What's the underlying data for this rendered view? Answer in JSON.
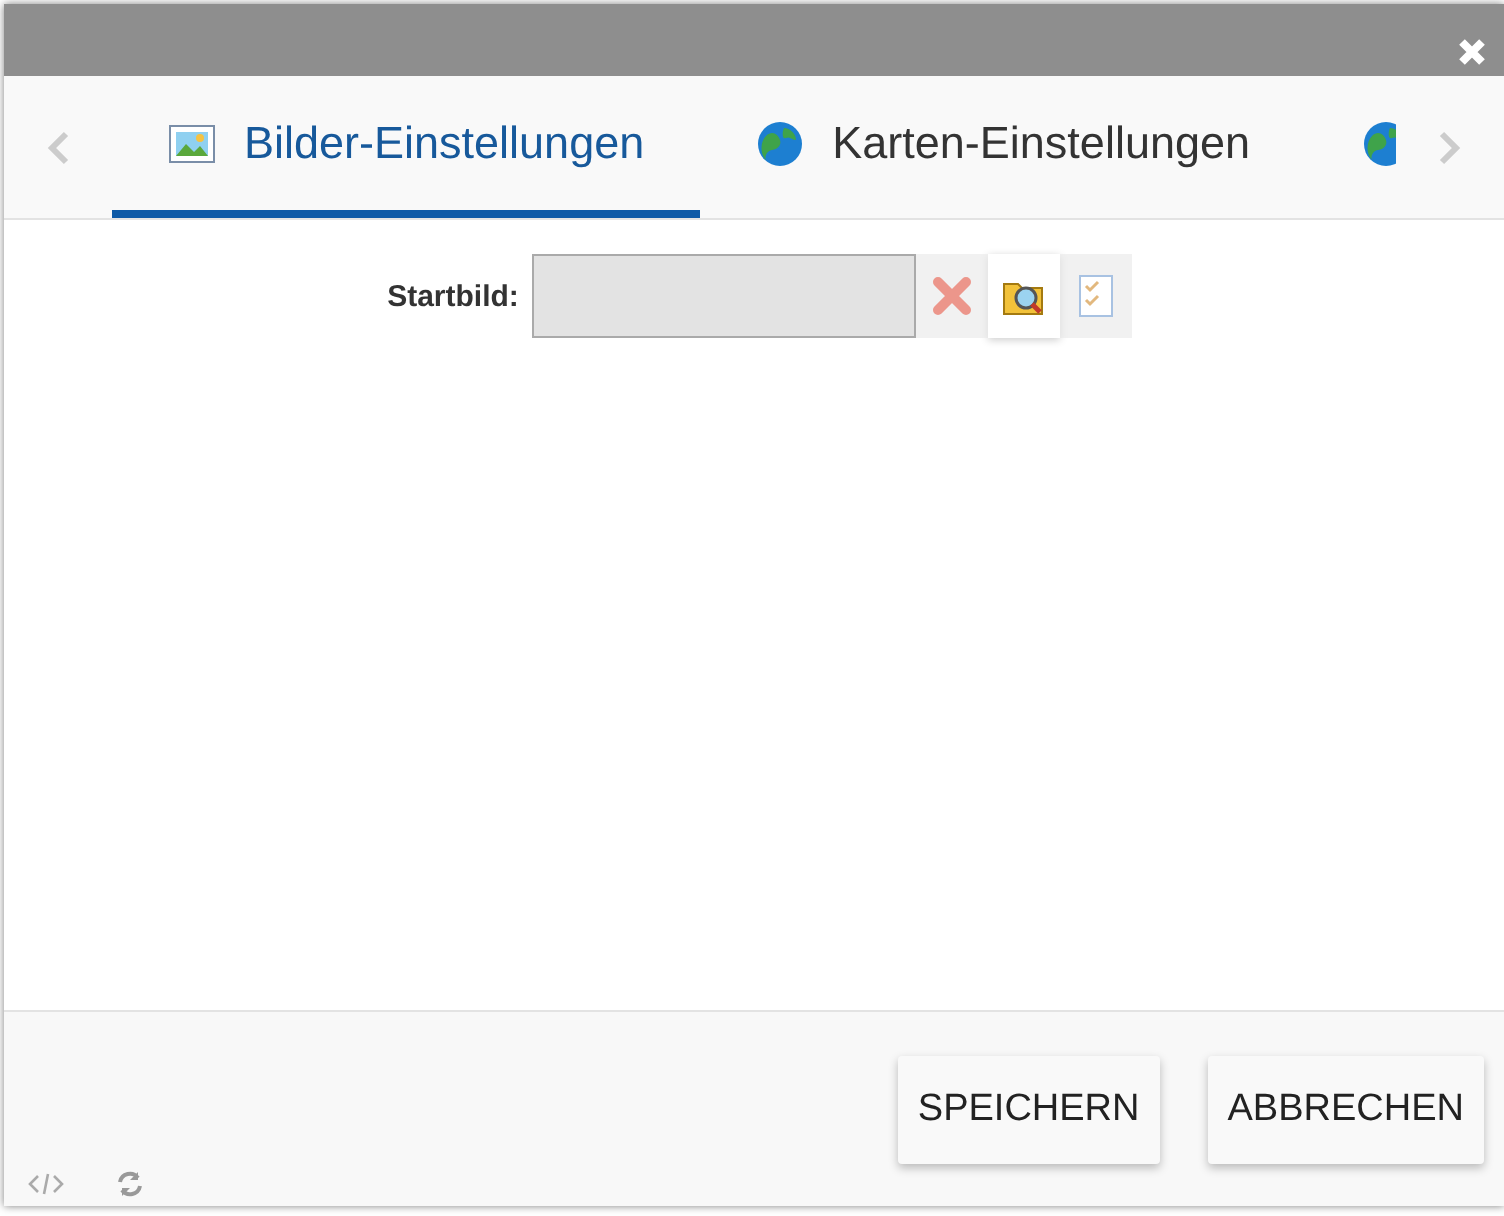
{
  "tabs": [
    {
      "label": "Bilder-Einstellungen",
      "kind": "picture",
      "selected": true
    },
    {
      "label": "Karten-Einstellungen",
      "kind": "globe",
      "selected": false
    },
    {
      "kind": "globe",
      "selected": false
    }
  ],
  "form": {
    "label": "Startbild:",
    "actions": [
      {
        "kind": "clear",
        "disabled": true
      },
      {
        "kind": "browse",
        "disabled": false
      },
      {
        "kind": "check",
        "disabled": true
      }
    ]
  },
  "buttons": [
    "SPEICHERN",
    "ABBRECHEN"
  ]
}
